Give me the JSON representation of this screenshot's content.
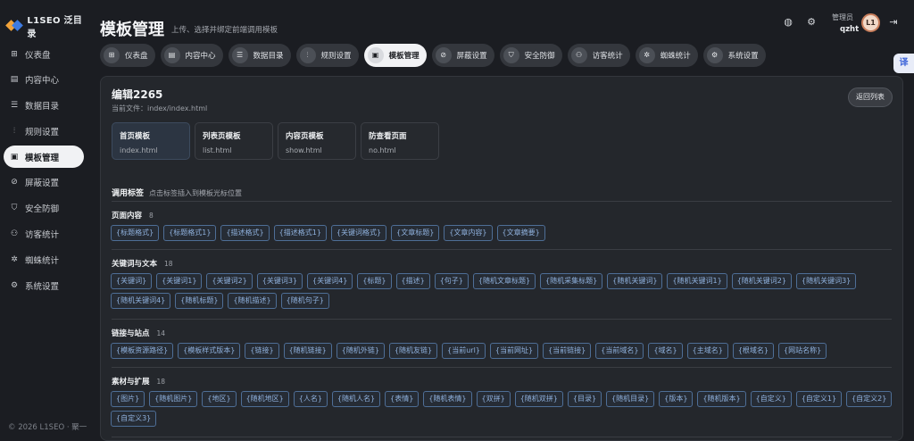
{
  "brand": {
    "name": "L1SEO 泛目录"
  },
  "sidebar": {
    "items": [
      {
        "label": "仪表盘",
        "icon": "grid-icon"
      },
      {
        "label": "内容中心",
        "icon": "document-icon"
      },
      {
        "label": "数据目录",
        "icon": "database-icon"
      },
      {
        "label": "规则设置",
        "icon": "rules-icon"
      },
      {
        "label": "模板管理",
        "icon": "template-icon",
        "active": true
      },
      {
        "label": "屏蔽设置",
        "icon": "block-icon"
      },
      {
        "label": "安全防御",
        "icon": "shield-icon"
      },
      {
        "label": "访客统计",
        "icon": "users-icon"
      },
      {
        "label": "蜘蛛统计",
        "icon": "spider-icon"
      },
      {
        "label": "系统设置",
        "icon": "gear-icon"
      }
    ],
    "footer": "© 2026 L1SEO · 聚一"
  },
  "header": {
    "title": "模板管理",
    "subtitle": "上传、选择并绑定前端调用模板",
    "user_role": "管理员",
    "user_name": "qzht",
    "avatar_text": "L1"
  },
  "tabs": [
    {
      "label": "仪表盘"
    },
    {
      "label": "内容中心"
    },
    {
      "label": "数据目录"
    },
    {
      "label": "规则设置"
    },
    {
      "label": "模板管理",
      "active": true
    },
    {
      "label": "屏蔽设置"
    },
    {
      "label": "安全防御"
    },
    {
      "label": "访客统计"
    },
    {
      "label": "蜘蛛统计"
    },
    {
      "label": "系统设置"
    }
  ],
  "float_button": "译",
  "editor": {
    "title": "编辑2265",
    "current_file": "当前文件：index/index.html",
    "back_label": "返回列表",
    "template_cards": [
      {
        "name": "首页模板",
        "file": "index.html",
        "active": true
      },
      {
        "name": "列表页模板",
        "file": "list.html"
      },
      {
        "name": "内容页模板",
        "file": "show.html"
      },
      {
        "name": "防查看页面",
        "file": "no.html"
      }
    ],
    "tags_title": "调用标签",
    "tags_hint": "点击标签插入到模板光标位置",
    "sections": [
      {
        "title": "页面内容",
        "count": "8",
        "tags": [
          "{标题格式}",
          "{标题格式1}",
          "{描述格式}",
          "{描述格式1}",
          "{关键词格式}",
          "{文章标题}",
          "{文章内容}",
          "{文章摘要}"
        ]
      },
      {
        "title": "关键词与文本",
        "count": "18",
        "tags": [
          "{关键词}",
          "{关键词1}",
          "{关键词2}",
          "{关键词3}",
          "{关键词4}",
          "{标题}",
          "{描述}",
          "{句子}",
          "{随机文章标题}",
          "{随机采集标题}",
          "{随机关键词}",
          "{随机关键词1}",
          "{随机关键词2}",
          "{随机关键词3}",
          "{随机关键词4}",
          "{随机标题}",
          "{随机描述}",
          "{随机句子}"
        ]
      },
      {
        "title": "链接与站点",
        "count": "14",
        "tags": [
          "{模板资源路径}",
          "{模板样式版本}",
          "{链接}",
          "{随机链接}",
          "{随机外链}",
          "{随机友链}",
          "{当前url}",
          "{当前网址}",
          "{当前链接}",
          "{当前域名}",
          "{域名}",
          "{主域名}",
          "{根域名}",
          "{网站名称}"
        ]
      },
      {
        "title": "素材与扩展",
        "count": "18",
        "tags": [
          "{图片}",
          "{随机图片}",
          "{地区}",
          "{随机地区}",
          "{人名}",
          "{随机人名}",
          "{表情}",
          "{随机表情}",
          "{双拼}",
          "{随机双拼}",
          "{目录}",
          "{随机目录}",
          "{版本}",
          "{随机版本}",
          "{自定义}",
          "{自定义1}",
          "{自定义2}",
          "{自定义3}"
        ]
      }
    ]
  }
}
